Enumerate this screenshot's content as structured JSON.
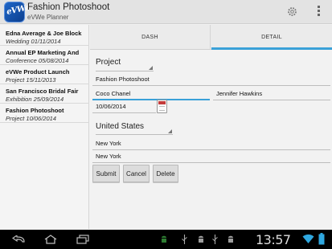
{
  "app": {
    "title": "Fashion Photoshoot",
    "subtitle": "eVWe Planner",
    "icon_text": "eVWe"
  },
  "events": [
    {
      "title": "Edna Average & Joe Block",
      "subtitle": "Wedding 01/11/2014"
    },
    {
      "title": "Annual EP Marketing And",
      "subtitle": "Conference 05/08/2014"
    },
    {
      "title": "eVWe Product Launch",
      "subtitle": "Project 15/11/2013"
    },
    {
      "title": "San Francisco Bridal Fair",
      "subtitle": "Exhibition 25/09/2014"
    },
    {
      "title": "Fashion Photoshoot",
      "subtitle": "Project 10/06/2014"
    }
  ],
  "tabs": {
    "dash": "DASH",
    "detail": "DETAIL"
  },
  "form": {
    "event_type": "Project",
    "event_name": "Fashion Photoshoot",
    "client": "Coco Chanel",
    "contact": "Jennifer Hawkins",
    "date": "10/06/2014",
    "country": "United States",
    "state": "New York",
    "city": "New York"
  },
  "buttons": {
    "submit": "Submit",
    "cancel": "Cancel",
    "delete": "Delete"
  },
  "system": {
    "time": "13:57"
  },
  "colors": {
    "accent": "#3aa1d8",
    "statusbar": "#000000"
  }
}
